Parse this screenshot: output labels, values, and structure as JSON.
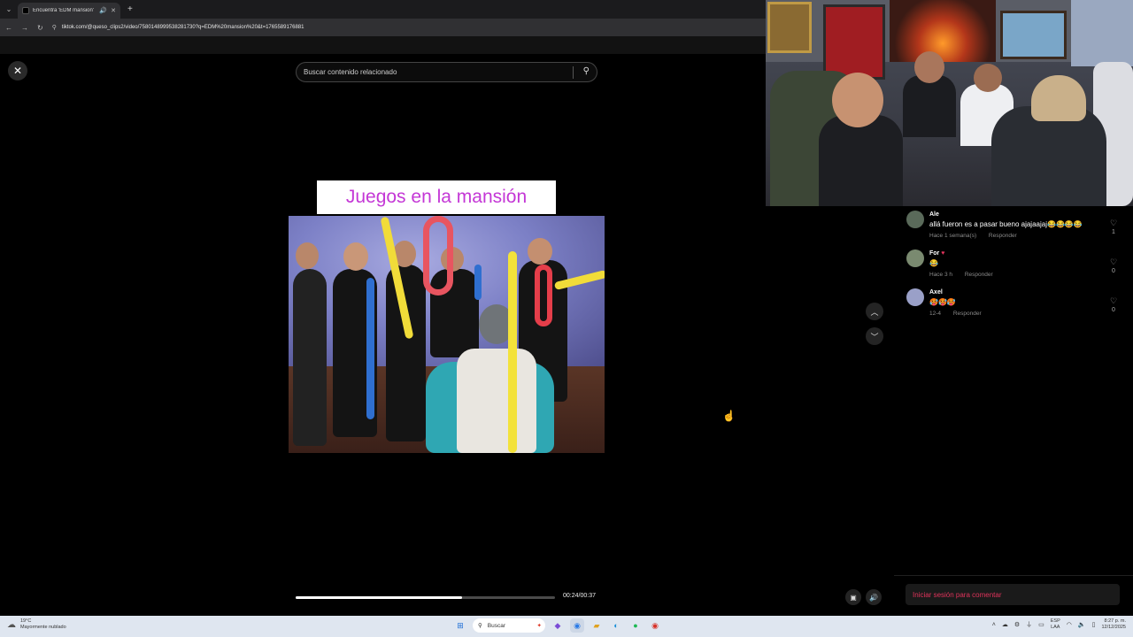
{
  "browser": {
    "tab_title": "Encuentra 'EDM mansion'",
    "new_tab_icon": "+",
    "url": "tiktok.com/@queso_clips2/video/7580148999538281730?q=EDM%20mansion%20&t=1765589176881"
  },
  "page": {
    "search_placeholder": "Buscar contenido relacionado",
    "video_caption": "Juegos en la mansión",
    "timecode": "00:24/00:37",
    "progress_fraction": 0.64,
    "login_prompt": "Iniciar sesión para comentar"
  },
  "comments": [
    {
      "user": "Ale",
      "text": "allá fueron es a pasar bueno ajajaajaj😂😂😂😂",
      "time": "Hace 1 semana(s)",
      "reply": "Responder",
      "likes": "1",
      "avatar_color": "#5a6a5a"
    },
    {
      "user": "For",
      "text": "😂",
      "time": "Hace 3 h",
      "reply": "Responder",
      "likes": "0",
      "avatar_color": "#7a8a70"
    },
    {
      "user": "Axel",
      "text": "🥵🥵🥵",
      "time": "12-4",
      "reply": "Responder",
      "likes": "0",
      "avatar_color": "#9aa0c8"
    }
  ],
  "taskbar": {
    "weather_temp": "19°C",
    "weather_desc": "Mayormente nublado",
    "search_label": "Buscar",
    "lang_top": "ESP",
    "lang_bottom": "LAA",
    "time": "8:27 p. m.",
    "date": "12/12/2025"
  },
  "colors": {
    "accent_caption": "#c437d6",
    "login_text": "#e0335b"
  }
}
